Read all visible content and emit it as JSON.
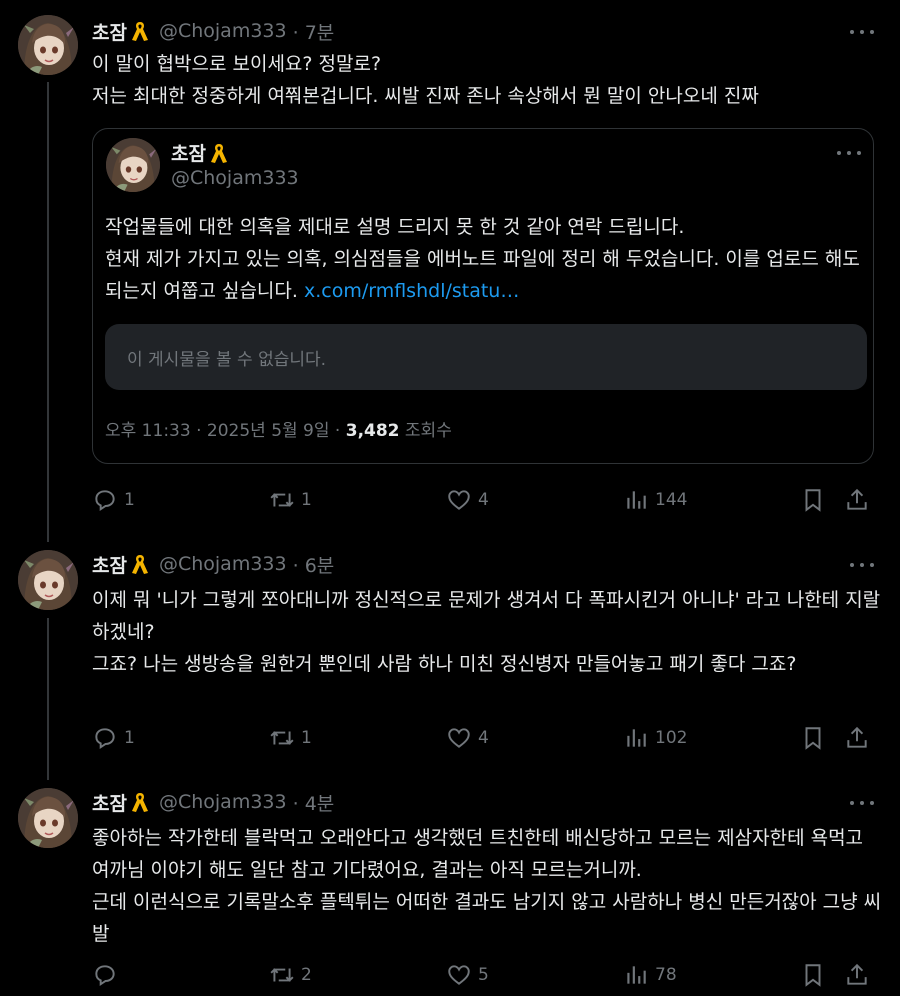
{
  "tweets": [
    {
      "name": "초잠",
      "handle": "@Chojam333",
      "time": "· 7분",
      "text": "이 말이 협박으로 보이세요? 정말로?\n저는 최대한 정중하게 여쭤본겁니다. 씨발 진짜 존나 속상해서 뭔 말이 안나오네 진짜",
      "quote": {
        "name": "초잠",
        "handle": "@Chojam333",
        "text": "작업물들에 대한 의혹을 제대로 설명 드리지 못 한 것 같아 연락 드립니다.\n현재 제가 가지고 있는 의혹, 의심점들을 에버노트 파일에 정리 해 두었습니다. 이를 업로드 해도 되는지 여쭙고 싶습니다. ",
        "link": "x.com/rmflshdl/statu…",
        "unavailable": "이 게시물을 볼 수 없습니다.",
        "meta_time": "오후 11:33 · 2025년 5월 9일 · ",
        "meta_views": "3,482",
        "meta_views_label": " 조회수"
      },
      "replies": "1",
      "reposts": "1",
      "likes": "4",
      "views": "144"
    },
    {
      "name": "초잠",
      "handle": "@Chojam333",
      "time": "· 6분",
      "text": "이제 뭐 '니가 그렇게 쪼아대니까 정신적으로 문제가 생겨서 다 폭파시킨거 아니냐' 라고 나한테 지랄하겠네?\n그죠? 나는 생방송을 원한거 뿐인데 사람 하나 미친 정신병자 만들어놓고 패기 좋다 그죠?",
      "replies": "1",
      "reposts": "1",
      "likes": "4",
      "views": "102"
    },
    {
      "name": "초잠",
      "handle": "@Chojam333",
      "time": "· 4분",
      "text": "좋아하는 작가한테 블락먹고 오래안다고 생각했던 트친한테 배신당하고 모르는 제삼자한테 욕먹고 여까님 이야기 해도 일단 참고 기다렸어요, 결과는 아직 모르는거니까.\n근데 이런식으로 기록말소후 플텍튀는 어떠한 결과도 남기지 않고 사람하나 병신 만든거잖아 그냥 씨발",
      "replies": "",
      "reposts": "2",
      "likes": "5",
      "views": "78"
    }
  ],
  "colors": {
    "background": "#000000",
    "text": "#e7e9ea",
    "muted": "#71767b",
    "link": "#1d9bf0",
    "ribbon": "#f5b400"
  },
  "icons": [
    "avatar",
    "yellow-ribbon-icon",
    "more-icon",
    "reply-icon",
    "repost-icon",
    "like-icon",
    "views-icon",
    "bookmark-icon",
    "share-icon"
  ]
}
